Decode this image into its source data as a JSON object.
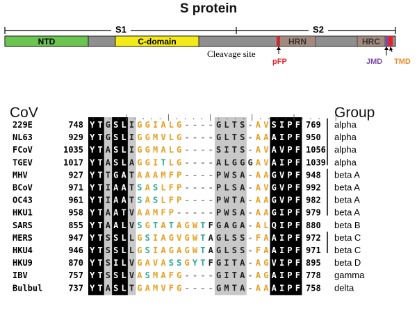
{
  "title": "S protein",
  "domains": {
    "s1": "S1",
    "s2": "S2",
    "ntd": "NTD",
    "cdomain": "C-domain",
    "hrn": "HRN",
    "hrc": "HRC",
    "cleavage": "Cleavage site",
    "pfp": "pFP",
    "jmd": "JMD",
    "tmd": "TMD"
  },
  "colors": {
    "ntd": "#6cc450",
    "cdomain": "#f4ea1a",
    "bar": "#8f8f8f",
    "hr": "#a38a7e",
    "pfp": "#e8202a",
    "jmd": "#7b4aa6",
    "tmd": "#f08a2a",
    "black_bg": "#000000",
    "grey_bg": "#c8c8c8",
    "res_orange": "#e8a020",
    "res_teal": "#30a898",
    "res_grey": "#909090"
  },
  "alignment": {
    "header_left": "CoV",
    "header_right": "Group",
    "ruler": ". . . . | . . . . | . . . . | . . . . | . . . . | . . . . |",
    "rows": [
      {
        "name": "229E",
        "start": "748",
        "seq": "YTGSLIGGIALG----GLTS-AVSIPF",
        "end": "769",
        "group": "alpha"
      },
      {
        "name": "NL63",
        "start": "929",
        "seq": "YTGSLIGGMVLG----GLTS-AAAIPF",
        "end": "950",
        "group": "alpha"
      },
      {
        "name": "FCoV",
        "start": "1035",
        "seq": "YTASLIGGMALG----SITS-AVAVPF",
        "end": "1056",
        "group": "alpha"
      },
      {
        "name": "TGEV",
        "start": "1017",
        "seq": "YTASLAGGITLG----ALGGGAVAIPF",
        "end": "1039",
        "group": "alpha"
      },
      {
        "name": "MHV",
        "start": "927",
        "seq": "YTTGATAAAMFP----PWSA-AAGVPF",
        "end": "948",
        "group": "beta A"
      },
      {
        "name": "BCoV",
        "start": "971",
        "seq": "YTIAATSASLFP----PLSA-AVGVPF",
        "end": "992",
        "group": "beta A"
      },
      {
        "name": "OC43",
        "start": "961",
        "seq": "YTIAATSASLFP----PWTA-AAGVPF",
        "end": "982",
        "group": "beta A"
      },
      {
        "name": "HKU1",
        "start": "958",
        "seq": "YTAATVAAMFP-----PWSA-AAGIPF",
        "end": "979",
        "group": "beta A"
      },
      {
        "name": "SARS",
        "start": "855",
        "seq": "YTAALVSGTATAGWTFGAGA-ALQIPF",
        "end": "880",
        "group": "beta B"
      },
      {
        "name": "MERS",
        "start": "947",
        "seq": "YTSSLLGSIAGVGWTAGLSS-FAAIPF",
        "end": "972",
        "group": "beta C"
      },
      {
        "name": "HKU4",
        "start": "946",
        "seq": "YTSSLLGSIAGAGWTAGLSS-FAAIPF",
        "end": "971",
        "group": "beta C"
      },
      {
        "name": "HKU9",
        "start": "870",
        "seq": "YTSILVGAVASSGYTFGITA-AGVIPF",
        "end": "895",
        "group": "beta D"
      },
      {
        "name": "IBV",
        "start": "757",
        "seq": "YTSSLVASMAFG----GITA-AGAIPF",
        "end": "778",
        "group": "gamma"
      },
      {
        "name": "Bulbul",
        "start": "737",
        "seq": "YTASLTGAMVFG----GMTA-AAAIPF",
        "end": "758",
        "group": "delta"
      }
    ]
  }
}
